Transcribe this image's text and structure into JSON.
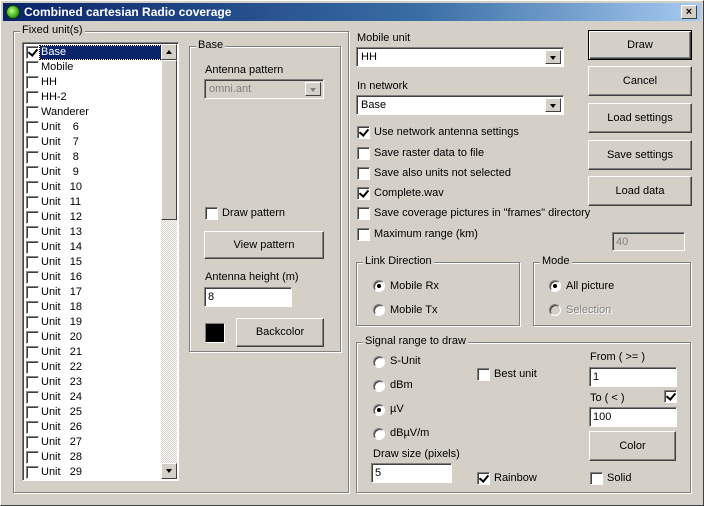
{
  "window": {
    "title": "Combined cartesian Radio coverage",
    "icon": "radio-globe-icon",
    "close_label": "×"
  },
  "fixed_units": {
    "group_label": "Fixed unit(s)",
    "items": [
      {
        "label": "Base",
        "checked": true,
        "selected": true
      },
      {
        "label": "Mobile",
        "checked": false
      },
      {
        "label": "HH",
        "checked": false
      },
      {
        "label": "HH-2",
        "checked": false
      },
      {
        "label": "Wanderer",
        "checked": false
      },
      {
        "label": "Unit    6",
        "checked": false
      },
      {
        "label": "Unit    7",
        "checked": false
      },
      {
        "label": "Unit    8",
        "checked": false
      },
      {
        "label": "Unit    9",
        "checked": false
      },
      {
        "label": "Unit   10",
        "checked": false
      },
      {
        "label": "Unit   11",
        "checked": false
      },
      {
        "label": "Unit   12",
        "checked": false
      },
      {
        "label": "Unit   13",
        "checked": false
      },
      {
        "label": "Unit   14",
        "checked": false
      },
      {
        "label": "Unit   15",
        "checked": false
      },
      {
        "label": "Unit   16",
        "checked": false
      },
      {
        "label": "Unit   17",
        "checked": false
      },
      {
        "label": "Unit   18",
        "checked": false
      },
      {
        "label": "Unit   19",
        "checked": false
      },
      {
        "label": "Unit   20",
        "checked": false
      },
      {
        "label": "Unit   21",
        "checked": false
      },
      {
        "label": "Unit   22",
        "checked": false
      },
      {
        "label": "Unit   23",
        "checked": false
      },
      {
        "label": "Unit   24",
        "checked": false
      },
      {
        "label": "Unit   25",
        "checked": false
      },
      {
        "label": "Unit   26",
        "checked": false
      },
      {
        "label": "Unit   27",
        "checked": false
      },
      {
        "label": "Unit   28",
        "checked": false
      },
      {
        "label": "Unit   29",
        "checked": false
      }
    ]
  },
  "base": {
    "group_label": "Base",
    "antenna_pattern_label": "Antenna pattern",
    "antenna_pattern_value": "omni.ant",
    "draw_pattern_label": "Draw pattern",
    "draw_pattern_checked": false,
    "view_pattern_button": "View pattern",
    "antenna_height_label": "Antenna height (m)",
    "antenna_height_value": "8",
    "backcolor_button": "Backcolor",
    "backcolor": "#000000"
  },
  "mobile_unit": {
    "label": "Mobile unit",
    "value": "HH"
  },
  "in_network": {
    "label": "In network",
    "value": "Base"
  },
  "options": [
    {
      "label": "Use network antenna settings",
      "checked": true
    },
    {
      "label": "Save raster data to file",
      "checked": false
    },
    {
      "label": "Save also units not selected",
      "checked": false
    },
    {
      "label": "Complete.wav",
      "checked": true
    },
    {
      "label": "Save coverage pictures in \"frames\" directory",
      "checked": false
    },
    {
      "label": "Maximum range (km)",
      "checked": false
    }
  ],
  "max_range_value": "40",
  "buttons": {
    "draw": "Draw",
    "cancel": "Cancel",
    "load_settings": "Load settings",
    "save_settings": "Save settings",
    "load_data": "Load data"
  },
  "link_direction": {
    "group_label": "Link Direction",
    "options": [
      {
        "label": "Mobile Rx",
        "selected": true
      },
      {
        "label": "Mobile Tx",
        "selected": false
      }
    ]
  },
  "mode": {
    "group_label": "Mode",
    "options": [
      {
        "label": "All picture",
        "selected": true
      },
      {
        "label": "Selection",
        "selected": false,
        "disabled": true
      }
    ]
  },
  "signal_range": {
    "group_label": "Signal range to draw",
    "units": [
      {
        "label": "S-Unit",
        "selected": false
      },
      {
        "label": "dBm",
        "selected": false
      },
      {
        "label": "µV",
        "selected": true
      },
      {
        "label": "dBµV/m",
        "selected": false
      }
    ],
    "best_unit_label": "Best unit",
    "best_unit_checked": false,
    "draw_size_label": "Draw size (pixels)",
    "draw_size_value": "5",
    "rainbow_label": "Rainbow",
    "rainbow_checked": true,
    "from_label": "From ( >= )",
    "from_value": "1",
    "to_label": "To ( < )",
    "to_checked": true,
    "to_value": "100",
    "color_button": "Color",
    "solid_label": "Solid",
    "solid_checked": false
  }
}
